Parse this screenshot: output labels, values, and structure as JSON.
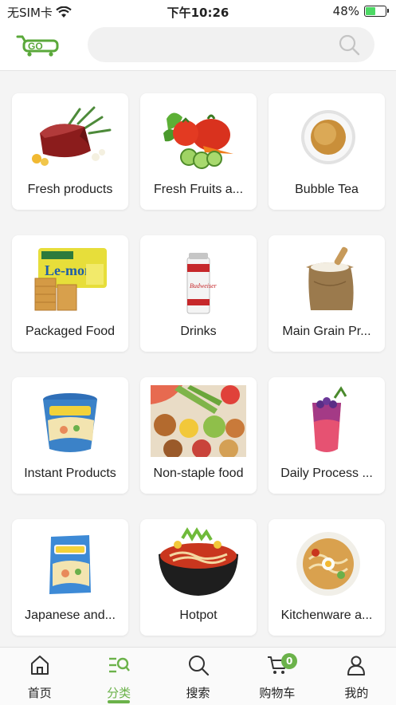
{
  "status_bar": {
    "carrier": "无SIM卡",
    "time": "下午10:26",
    "battery": "48%",
    "battery_level": 0.48
  },
  "header": {
    "search_placeholder": ""
  },
  "categories": [
    {
      "label": "Fresh products",
      "icon": "meat-image"
    },
    {
      "label": "Fresh Fruits a...",
      "icon": "vegetables-image"
    },
    {
      "label": "Bubble Tea",
      "icon": "tea-cup-image"
    },
    {
      "label": "Packaged Food",
      "icon": "crackers-image"
    },
    {
      "label": "Drinks",
      "icon": "beer-can-image"
    },
    {
      "label": "Main Grain Pr...",
      "icon": "grain-sack-image"
    },
    {
      "label": "Instant Products",
      "icon": "noodle-cup-image"
    },
    {
      "label": "Non-staple food",
      "icon": "nuts-fruits-image"
    },
    {
      "label": "Daily Process ...",
      "icon": "drink-glass-image"
    },
    {
      "label": "Japanese and...",
      "icon": "noodle-pack-image"
    },
    {
      "label": "Hotpot",
      "icon": "hotpot-bowl-image"
    },
    {
      "label": "Kitchenware a...",
      "icon": "ramen-bowl-image"
    }
  ],
  "tabbar": {
    "items": [
      {
        "label": "首页",
        "icon": "home-icon"
      },
      {
        "label": "分类",
        "icon": "category-icon",
        "active": true
      },
      {
        "label": "搜索",
        "icon": "search-icon"
      },
      {
        "label": "购物车",
        "icon": "cart-icon",
        "badge": "0"
      },
      {
        "label": "我的",
        "icon": "profile-icon"
      }
    ]
  },
  "colors": {
    "accent": "#6bb24a",
    "background": "#f4f4f4"
  }
}
